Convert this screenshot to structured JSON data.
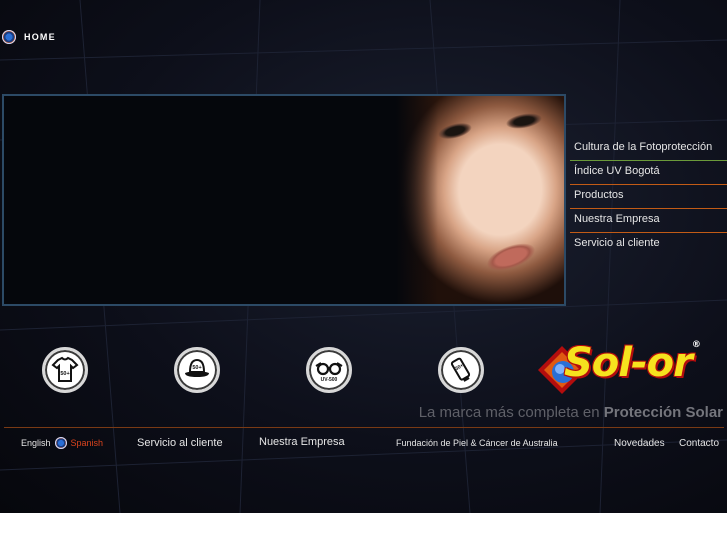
{
  "topnav": {
    "home_label": "HOME"
  },
  "side_menu": {
    "items": [
      {
        "label": "Cultura de la Fotoprotección"
      },
      {
        "label": "Índice UV Bogotá"
      },
      {
        "label": "Productos"
      },
      {
        "label": "Nuestra Empresa"
      },
      {
        "label": "Servicio al cliente"
      }
    ]
  },
  "badges": [
    {
      "icon": "tshirt-50-icon",
      "text": "50+"
    },
    {
      "icon": "hat-50-icon",
      "text": "50+"
    },
    {
      "icon": "sunglasses-uv500-icon",
      "text": "UV-500"
    },
    {
      "icon": "sunscreen-30-icon",
      "text": "30+"
    }
  ],
  "brand": {
    "name": "Sol-or",
    "registered": "®",
    "tagline_prefix": "La marca más completa en",
    "tagline_strong": "Protección Solar"
  },
  "footer": {
    "lang_english": "English",
    "lang_spanish": "Spanish",
    "links": [
      {
        "label": "Servicio al cliente"
      },
      {
        "label": "Nuestra Empresa"
      },
      {
        "label": "Fundación de Piel & Cáncer de Australia"
      },
      {
        "label": "Novedades"
      },
      {
        "label": "Contacto"
      }
    ]
  },
  "colors": {
    "accent_orange": "#c25b16",
    "accent_green": "#6b9a3a",
    "brand_yellow": "#f6e21e",
    "brand_red": "#b30d0d",
    "background": "#0d0f1a"
  }
}
